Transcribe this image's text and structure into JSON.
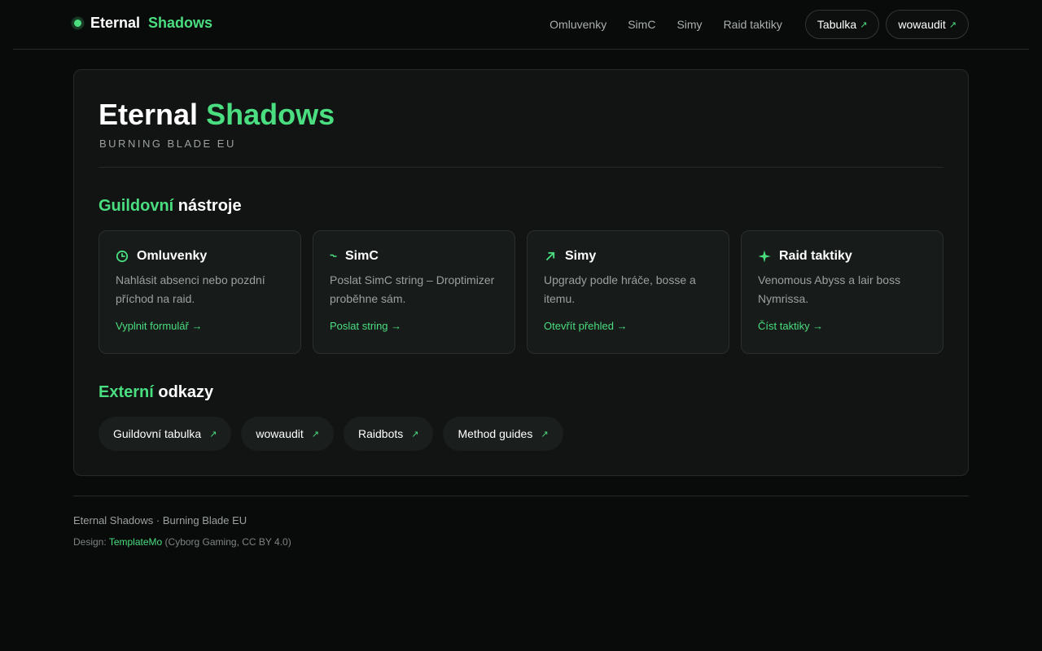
{
  "brand": {
    "name_a": "Eternal",
    "name_b": "Shadows"
  },
  "nav": {
    "links": [
      "Omluvenky",
      "SimC",
      "Simy",
      "Raid taktiky"
    ],
    "pills": [
      "Tabulka",
      "wowaudit"
    ]
  },
  "hero": {
    "title_a": "Eternal",
    "title_b": "Shadows",
    "subtitle": "BURNING BLADE EU"
  },
  "tools": {
    "title_a": "Guildovní",
    "title_b": "nástroje",
    "cards": [
      {
        "title": "Omluvenky",
        "icon": "clock-icon",
        "desc": "Nahlásit absenci nebo pozdní příchod na raid.",
        "link": "Vyplnit formulář →"
      },
      {
        "title": "SimC",
        "icon": "dash-icon",
        "desc": "Poslat SimC string – Droptimizer proběhne sám.",
        "link": "Poslat string →"
      },
      {
        "title": "Simy",
        "icon": "arrow-up-right-icon",
        "desc": "Upgrady podle hráče, bosse a itemu.",
        "link": "Otevřít přehled →"
      },
      {
        "title": "Raid taktiky",
        "icon": "sparkle-icon",
        "desc": "Venomous Abyss a lair boss Nymrissa.",
        "link": "Číst taktiky →"
      }
    ]
  },
  "external": {
    "title_a": "Externí",
    "title_b": "odkazy",
    "links": [
      "Guildovní tabulka",
      "wowaudit",
      "Raidbots",
      "Method guides"
    ]
  },
  "footer": {
    "line1": "Eternal Shadows · Burning Blade EU",
    "design_prefix": "Design:",
    "design_link": "TemplateMo",
    "design_suffix": "(Cyborg Gaming, CC BY 4.0)"
  },
  "colors": {
    "accent": "#4ade80",
    "background": "#090b0a",
    "panel": "#111413"
  }
}
